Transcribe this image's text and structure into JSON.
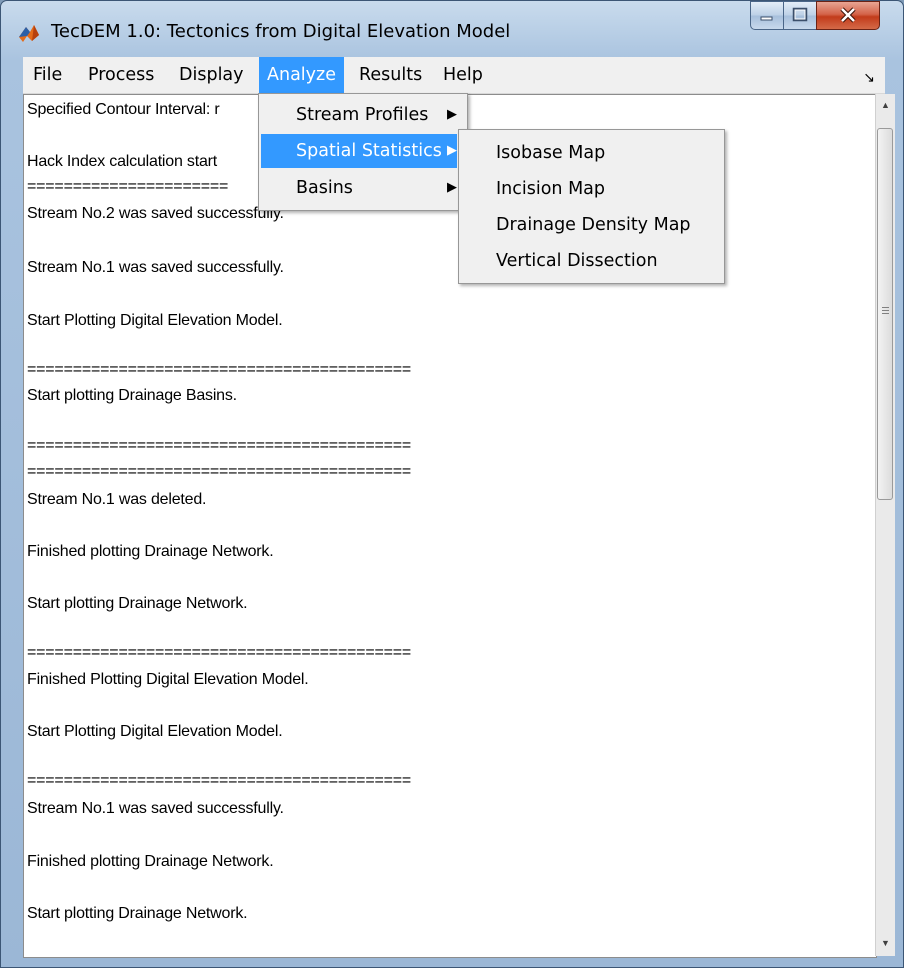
{
  "window": {
    "title": "TecDEM 1.0: Tectonics from Digital Elevation Model",
    "controls": {
      "minimize": "minimize-icon",
      "maximize": "maximize-icon",
      "close": "close-icon"
    }
  },
  "menubar": {
    "items": [
      "File",
      "Process",
      "Display",
      "Analyze",
      "Results",
      "Help"
    ],
    "active": "Analyze",
    "chevron": "↘"
  },
  "analyze_menu": {
    "items": [
      {
        "label": "Stream Profiles",
        "arrow": "▶"
      },
      {
        "label": "Spatial Statistics",
        "arrow": "▶"
      },
      {
        "label": "Basins",
        "arrow": "▶"
      }
    ],
    "highlighted": "Spatial Statistics"
  },
  "spatial_submenu": {
    "items": [
      "Isobase Map",
      "Incision Map",
      "Drainage Density Map",
      "Vertical Dissection"
    ]
  },
  "log": [
    "Specified Contour Interval: r",
    "Hack Index calculation start",
    "======================",
    "Stream No.2 was saved successfully.",
    "Stream No.1 was saved successfully.",
    "Start Plotting Digital Elevation Model.",
    "==========================================",
    "Start plotting Drainage Basins.",
    "==========================================",
    "==========================================",
    "Stream No.1 was deleted.",
    "Finished plotting Drainage Network.",
    "Start plotting Drainage Network.",
    "==========================================",
    "Finished Plotting Digital Elevation Model.",
    "Start Plotting Digital Elevation Model.",
    "==========================================",
    "Stream No.1 was saved successfully.",
    "Finished plotting Drainage Network.",
    "Start plotting Drainage Network."
  ],
  "scrollbar": {
    "up_arrow": "▲",
    "down_arrow": "▼"
  },
  "colors": {
    "menu_highlight": "#3399ff",
    "menu_background": "#f0f0f0",
    "window_frame": "#a9c3df"
  }
}
